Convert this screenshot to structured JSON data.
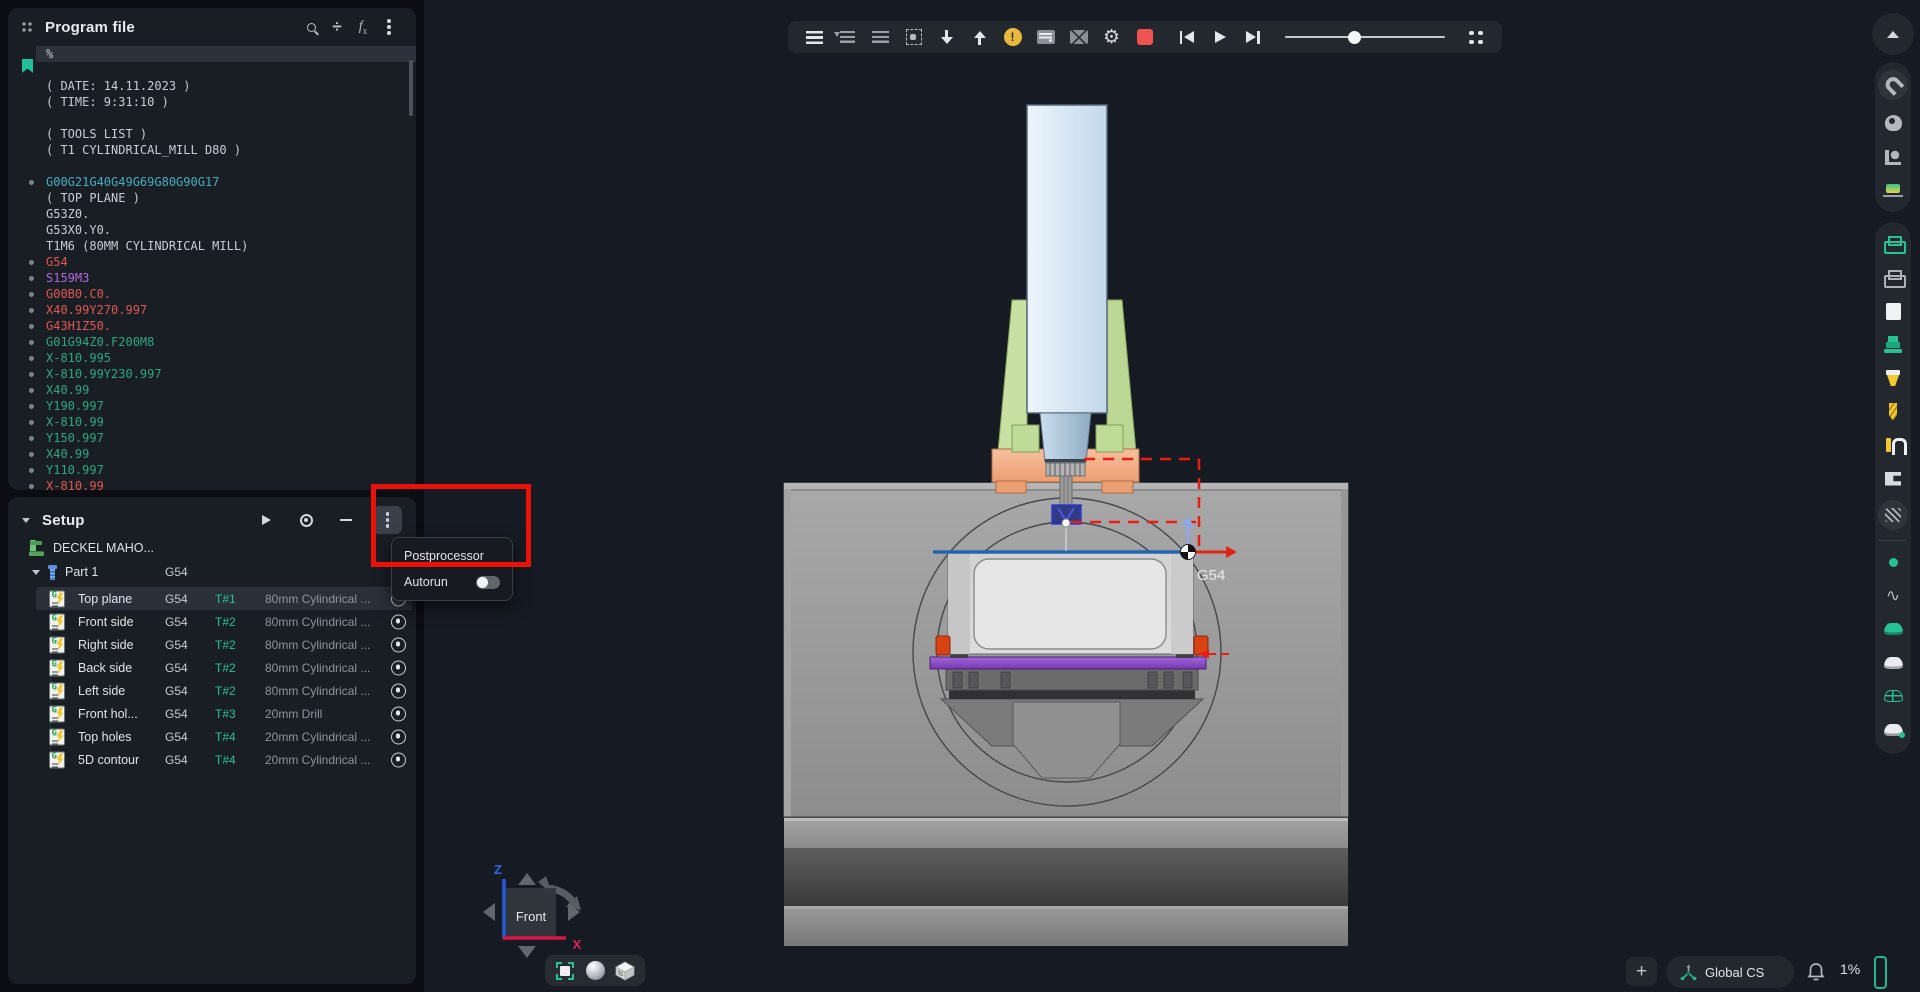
{
  "program_panel": {
    "title": "Program file",
    "lines": [
      {
        "text": "%",
        "color": "plain",
        "bullet": false,
        "bookmark": true,
        "highlight": true
      },
      {
        "text": "",
        "color": "plain",
        "bullet": false
      },
      {
        "text": "( DATE: 14.11.2023 )",
        "color": "plain",
        "bullet": false
      },
      {
        "text": "( TIME: 9:31:10 )",
        "color": "plain",
        "bullet": false
      },
      {
        "text": "",
        "color": "plain",
        "bullet": false
      },
      {
        "text": "( TOOLS LIST )",
        "color": "plain",
        "bullet": false
      },
      {
        "text": "( T1 CYLINDRICAL_MILL D80 )",
        "color": "plain",
        "bullet": false
      },
      {
        "text": "",
        "color": "plain",
        "bullet": false
      },
      {
        "text": "G00G21G40G49G69G80G90G17",
        "color": "teal",
        "bullet": true
      },
      {
        "text": "( TOP PLANE )",
        "color": "plain",
        "bullet": false
      },
      {
        "text": "G53Z0.",
        "color": "plain",
        "bullet": false
      },
      {
        "text": "G53X0.Y0.",
        "color": "plain",
        "bullet": false
      },
      {
        "text": "T1M6 (80MM CYLINDRICAL MILL)",
        "color": "plain",
        "bullet": false
      },
      {
        "text": "G54",
        "color": "red",
        "bullet": true
      },
      {
        "text": "S159M3",
        "color": "purple",
        "bullet": true
      },
      {
        "text": "G00B0.C0.",
        "color": "red",
        "bullet": true
      },
      {
        "text": "X40.99Y270.997",
        "color": "red",
        "bullet": true
      },
      {
        "text": "G43H1Z50.",
        "color": "red",
        "bullet": true
      },
      {
        "text": "G01G94Z0.F200M8",
        "color": "green",
        "bullet": true
      },
      {
        "text": "X-810.995",
        "color": "green",
        "bullet": true
      },
      {
        "text": "X-810.99Y230.997",
        "color": "green",
        "bullet": true
      },
      {
        "text": "X40.99",
        "color": "green",
        "bullet": true
      },
      {
        "text": "Y190.997",
        "color": "green",
        "bullet": true
      },
      {
        "text": "X-810.99",
        "color": "green",
        "bullet": true
      },
      {
        "text": "Y150.997",
        "color": "green",
        "bullet": true
      },
      {
        "text": "X40.99",
        "color": "green",
        "bullet": true
      },
      {
        "text": "Y110.997",
        "color": "green",
        "bullet": true
      },
      {
        "text": "X-810.99",
        "color": "red",
        "bullet": true
      }
    ]
  },
  "setup_panel": {
    "title": "Setup",
    "machine_name": "DECKEL MAHO...",
    "part": {
      "name": "Part 1",
      "wcs": "G54"
    },
    "operations": [
      {
        "name": "Top plane",
        "wcs": "G54",
        "tool": "T#1",
        "desc": "80mm Cylindrical ...",
        "selected": true
      },
      {
        "name": "Front side",
        "wcs": "G54",
        "tool": "T#2",
        "desc": "80mm Cylindrical ...",
        "selected": false
      },
      {
        "name": "Right side",
        "wcs": "G54",
        "tool": "T#2",
        "desc": "80mm Cylindrical ...",
        "selected": false
      },
      {
        "name": "Back side",
        "wcs": "G54",
        "tool": "T#2",
        "desc": "80mm Cylindrical ...",
        "selected": false
      },
      {
        "name": "Left side",
        "wcs": "G54",
        "tool": "T#2",
        "desc": "80mm Cylindrical ...",
        "selected": false
      },
      {
        "name": "Front hol...",
        "wcs": "G54",
        "tool": "T#3",
        "desc": "20mm Drill",
        "selected": false
      },
      {
        "name": "Top holes",
        "wcs": "G54",
        "tool": "T#4",
        "desc": "20mm Cylindrical ...",
        "selected": false
      },
      {
        "name": "5D contour",
        "wcs": "G54",
        "tool": "T#4",
        "desc": "20mm Cylindrical ...",
        "selected": false
      }
    ]
  },
  "context_menu": {
    "postprocessor_label": "Postprocessor",
    "autorun_label": "Autorun",
    "autorun_state": "off"
  },
  "toolbar": {
    "items": [
      {
        "name": "program-lines-icon",
        "glyph": "bars-bright"
      },
      {
        "name": "goto-line-icon",
        "glyph": "bars-down"
      },
      {
        "name": "line-density-icon",
        "glyph": "bars-dim"
      },
      {
        "name": "fit-selection-icon",
        "glyph": "frame"
      },
      {
        "name": "step-down-icon",
        "glyph": "arrow-down"
      },
      {
        "name": "step-up-icon",
        "glyph": "arrow-up"
      },
      {
        "name": "warnings-icon",
        "glyph": "warning",
        "badge": "!"
      },
      {
        "name": "program-info-icon",
        "glyph": "card"
      },
      {
        "name": "toolpath-visibility-icon",
        "glyph": "crossed"
      },
      {
        "name": "simulation-settings-icon",
        "glyph": "gear",
        "char": "⚙"
      },
      {
        "name": "stop-button",
        "glyph": "stop"
      },
      {
        "name": "skip-to-start-button",
        "glyph": "skip-start"
      },
      {
        "name": "play-button",
        "glyph": "play"
      },
      {
        "name": "skip-to-end-button",
        "glyph": "skip-end"
      },
      {
        "name": "speed-slider",
        "glyph": "slider"
      },
      {
        "name": "detach-toolbar-icon",
        "glyph": "dots"
      }
    ],
    "slider_position": 0.42
  },
  "right_sidebar": {
    "collapse_icon": "chevron-up",
    "group1": [
      {
        "name": "magnet-icon",
        "glyph": "magnet",
        "circle": true
      },
      {
        "name": "probe-camera-icon",
        "glyph": "robot",
        "circle": false
      },
      {
        "name": "fixture-clamp-icon",
        "glyph": "clamp",
        "circle": false
      },
      {
        "name": "stock-material-icon",
        "glyph": "stock-color",
        "circle": false
      }
    ],
    "group2": [
      {
        "name": "machine-visible-icon",
        "glyph": "machine-green",
        "circle": false
      },
      {
        "name": "machine-hidden-icon",
        "glyph": "machine-gray",
        "circle": false
      },
      {
        "name": "stock-plain-icon",
        "glyph": "white-square",
        "circle": false
      },
      {
        "name": "workpiece-icon",
        "glyph": "stock-teal",
        "circle": false
      },
      {
        "name": "tool-cutter-icon",
        "glyph": "cutter",
        "circle": false
      },
      {
        "name": "tool-drill-icon",
        "glyph": "drill",
        "circle": false
      },
      {
        "name": "tool-holder-icon",
        "glyph": "holder",
        "circle": false
      },
      {
        "name": "vise-icon",
        "glyph": "vise",
        "circle": false
      },
      {
        "name": "section-hatch-icon",
        "glyph": "hatch",
        "circle": true
      },
      {
        "name": "divider",
        "glyph": "divider",
        "circle": false
      },
      {
        "name": "point-icon",
        "glyph": "dot",
        "circle": false
      },
      {
        "name": "curve-icon",
        "glyph": "squiggle",
        "char": "∿",
        "circle": false
      },
      {
        "name": "surface-shaded-icon",
        "glyph": "surface-teal",
        "circle": false
      },
      {
        "name": "surface-plain-icon",
        "glyph": "surface-white",
        "circle": false
      },
      {
        "name": "surface-wireframe-icon",
        "glyph": "surface-wire",
        "circle": false
      },
      {
        "name": "surface-points-icon",
        "glyph": "surface-dot",
        "circle": false
      }
    ]
  },
  "viewport": {
    "view_cube_label": "Front",
    "axis_x_label": "X",
    "axis_z_label": "Z",
    "wcs_marker_label": "G54"
  },
  "bottom_bar": {
    "plus_label": "+",
    "cs_button_label": "Global CS",
    "battery_percent": "1%"
  },
  "colors": {
    "accent_teal": "#1fbf9a",
    "annotation_red": "#ea1208",
    "code_teal": "#46aec2",
    "code_red": "#e05850",
    "code_purple": "#b168e0",
    "code_green": "#2ca87e",
    "warning_amber": "#e8b93c",
    "stop_red": "#ef5350"
  }
}
